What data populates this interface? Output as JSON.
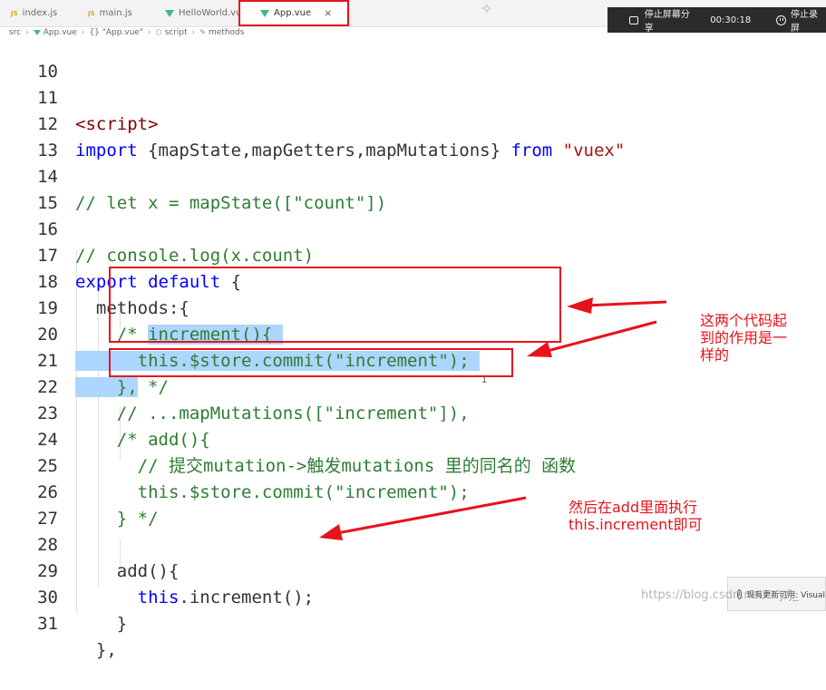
{
  "tabs": [
    {
      "label": "index.js",
      "icon": "js-file-icon"
    },
    {
      "label": "main.js",
      "icon": "js-file-icon"
    },
    {
      "label": "HelloWorld.vue",
      "icon": "vue-file-icon"
    },
    {
      "label": "App.vue",
      "icon": "vue-file-icon",
      "active": true,
      "close": "×"
    }
  ],
  "breadcrumb": [
    "src",
    "App.vue",
    "{} \"App.vue\"",
    "script",
    "methods"
  ],
  "share_bar": {
    "stop_share_label": "停止屏幕分享",
    "timer": "00:30:18",
    "stop_record_label": "停止录屏"
  },
  "code_lines": [
    {
      "n": "10"
    },
    {
      "n": "11",
      "t1": "<script>"
    },
    {
      "n": "12",
      "t1": "import",
      "t2": " {mapState,mapGetters,mapMutations} ",
      "t3": "from",
      "t4": " \"vuex\""
    },
    {
      "n": "13"
    },
    {
      "n": "14",
      "t1": "// let x = mapState([\"count\"])"
    },
    {
      "n": "15"
    },
    {
      "n": "16",
      "t1": "// console.log(x.count)"
    },
    {
      "n": "17",
      "t1": "export",
      "t2": " ",
      "t3": "default",
      "t4": " {"
    },
    {
      "n": "18",
      "t1": "  methods:{"
    },
    {
      "n": "19",
      "t1": "    /* ",
      "t2": "increment(){ "
    },
    {
      "n": "20",
      "t1": "      this.$store.commit(\"increment\"); "
    },
    {
      "n": "21",
      "t1": "    },",
      "t2": " */"
    },
    {
      "n": "22",
      "t1": "    // ...mapMutations([\"increment\"]),"
    },
    {
      "n": "23",
      "t1": "    /* add(){"
    },
    {
      "n": "24",
      "t1": "      // 提交mutation->触发mutations 里的同名的 函数"
    },
    {
      "n": "25",
      "t1": "      this.$store.commit(\"increment\");"
    },
    {
      "n": "26",
      "t1": "    } */"
    },
    {
      "n": "27"
    },
    {
      "n": "28",
      "t1": "    add(){"
    },
    {
      "n": "29",
      "t1": "      ",
      "t2": "this",
      "t3": ".increment();"
    },
    {
      "n": "30",
      "t1": "    }"
    },
    {
      "n": "31",
      "t1": "  },"
    }
  ],
  "annotations": {
    "note_same": "这两个代码起\n到的作用是一\n样的",
    "note_then": "然后在add里面执行\nthis.increment即可",
    "color": "#e8111c"
  },
  "toast_text": "现有更新可用: Visual",
  "watermark": "https://blog.csdn.net/...y/J_"
}
